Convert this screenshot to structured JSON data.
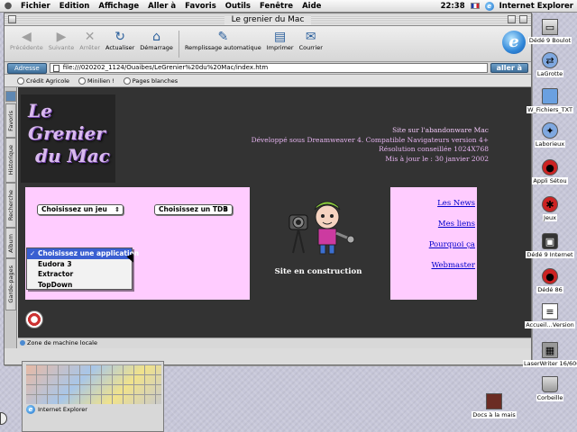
{
  "menubar": {
    "items": [
      "Fichier",
      "Edition",
      "Affichage",
      "Aller à",
      "Favoris",
      "Outils",
      "Fenêtre",
      "Aide"
    ],
    "clock": "22:38",
    "app_name": "Internet Explorer"
  },
  "window": {
    "title": "Le grenier du Mac"
  },
  "toolbar": {
    "back": "Précédente",
    "forward": "Suivante",
    "stop": "Arrêter",
    "refresh": "Actualiser",
    "home": "Démarrage",
    "autofill": "Remplissage automatique",
    "print": "Imprimer",
    "mail": "Courrier"
  },
  "address": {
    "label": "Adresse",
    "value": "file:///020202_1124/Ouaibes/LeGrenier%20du%20Mac/index.htm",
    "go": "aller à"
  },
  "favorites": {
    "items": [
      "Crédit Agricole",
      "Minilien !",
      "Pages blanches"
    ]
  },
  "side_tabs": [
    "Favoris",
    "Historique",
    "Recherche",
    "Album",
    "Garde-pages"
  ],
  "page": {
    "logo_lines": [
      "Le",
      "Grenier",
      "du Mac"
    ],
    "info_lines": [
      "Site sur l'abandonware Mac",
      "Développé sous Dreamweaver 4. Compatible Navigateurs version 4+",
      "Résolution conseillée 1024X768",
      "Mis à jour le : 30 janvier 2002"
    ],
    "select_jeu": "Choisissez un jeu",
    "select_tdb": "Choisissez un TDB",
    "construction_text": "Site en construction",
    "links": [
      "Les News",
      "Mes liens",
      "Pourquoi ça",
      "Webmaster"
    ]
  },
  "app_dropdown": {
    "options": [
      "Choisissez une application",
      "Eudora 3",
      "Extractor",
      "TopDown"
    ],
    "selected_index": 0
  },
  "status": {
    "text": "Zone de machine locale"
  },
  "palette": {
    "app_label": "Internet Explorer"
  },
  "desktop_icons": [
    {
      "label": "Dédé 9 Boulot",
      "icon": "hard-disk-icon"
    },
    {
      "label": "LaGrotte",
      "icon": "network-alias-icon"
    },
    {
      "label": "W_Fichiers_TXT",
      "icon": "folder-icon"
    },
    {
      "label": "Laborieux",
      "icon": "alias-icon"
    },
    {
      "label": "Appli Sétou",
      "icon": "ladybug-icon"
    },
    {
      "label": "Jeux",
      "icon": "bug-icon"
    },
    {
      "label": "Dédé 9 Internet",
      "icon": "tv-icon"
    },
    {
      "label": "Dédé 86",
      "icon": "ladybug-icon"
    },
    {
      "label": "Accueil…Version",
      "icon": "document-icon"
    },
    {
      "label": "LaserWriter 16/600 PS",
      "icon": "printer-icon"
    },
    {
      "label": "Corbeille",
      "icon": "trash-icon"
    },
    {
      "label": "Docs à la mais",
      "icon": "book-icon"
    }
  ],
  "colors": {
    "page_bg": "#333333",
    "panel_pink": "#ffccff",
    "info_text": "#e6b4f0",
    "link_blue": "#0000cc",
    "menu_highlight": "#3a5fd1"
  }
}
